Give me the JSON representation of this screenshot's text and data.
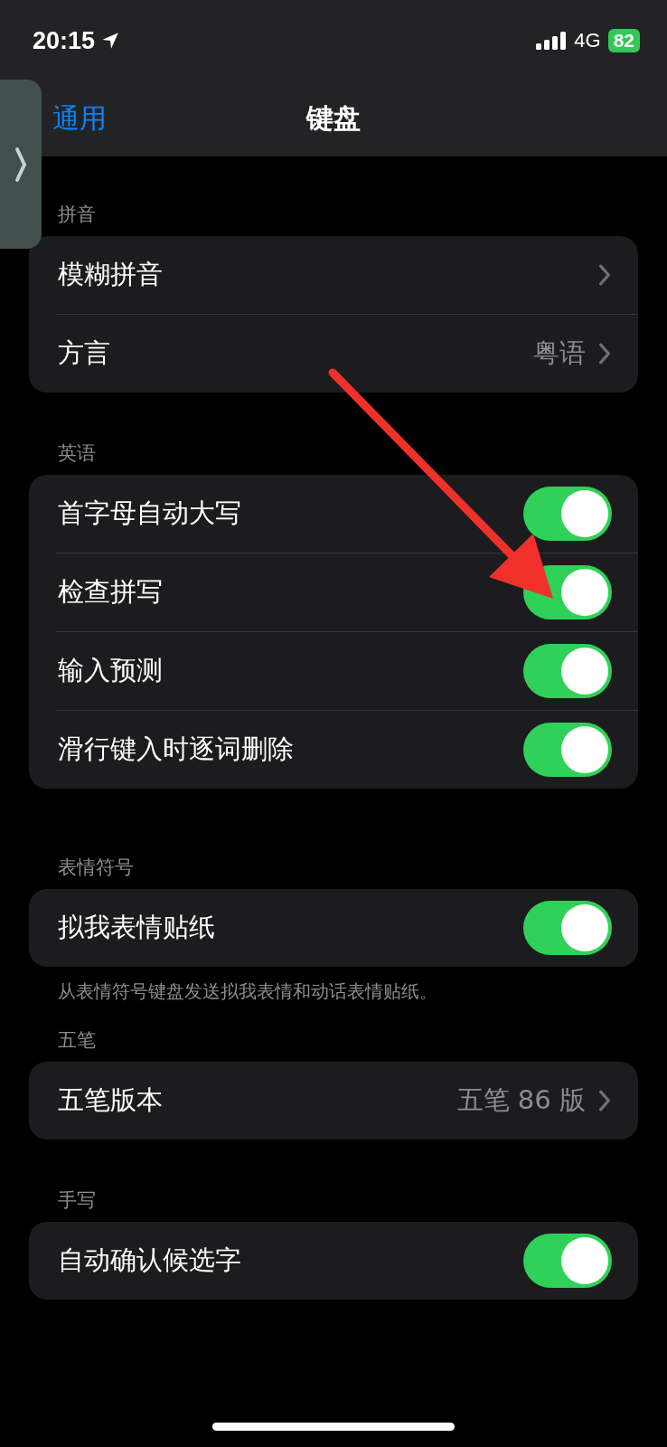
{
  "status_bar": {
    "time": "20:15",
    "network": "4G",
    "battery": "82"
  },
  "nav": {
    "back": "通用",
    "title": "键盘"
  },
  "sections": [
    {
      "header": "拼音",
      "rows": [
        {
          "kind": "link",
          "label": "模糊拼音"
        },
        {
          "kind": "link",
          "label": "方言",
          "value": "粤语"
        }
      ]
    },
    {
      "header": "英语",
      "rows": [
        {
          "kind": "toggle",
          "label": "首字母自动大写",
          "on": true
        },
        {
          "kind": "toggle",
          "label": "检查拼写",
          "on": true
        },
        {
          "kind": "toggle",
          "label": "输入预测",
          "on": true
        },
        {
          "kind": "toggle",
          "label": "滑行键入时逐词删除",
          "on": true
        }
      ]
    },
    {
      "header": "表情符号",
      "rows": [
        {
          "kind": "toggle",
          "label": "拟我表情贴纸",
          "on": true
        }
      ],
      "footer": "从表情符号键盘发送拟我表情和动话表情贴纸。"
    },
    {
      "header": "五笔",
      "rows": [
        {
          "kind": "link",
          "label": "五笔版本",
          "value": "五笔 86 版"
        }
      ]
    },
    {
      "header": "手写",
      "rows": [
        {
          "kind": "toggle",
          "label": "自动确认候选字",
          "on": true
        }
      ]
    }
  ]
}
